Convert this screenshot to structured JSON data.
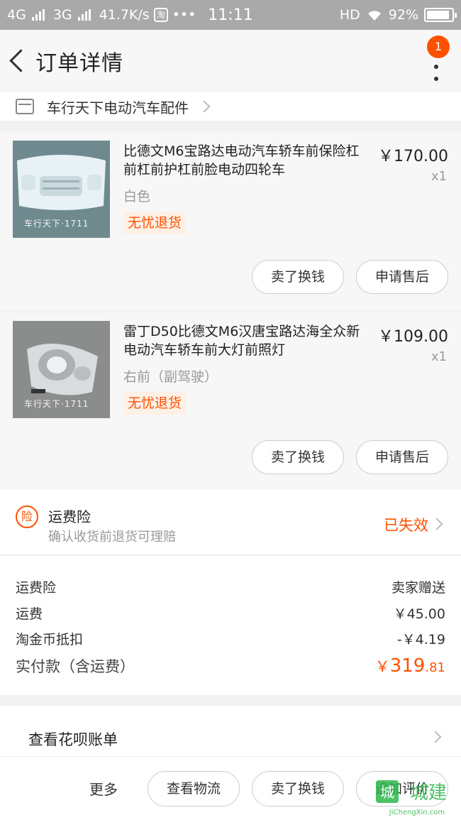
{
  "status_bar": {
    "network1": "4G",
    "network2": "3G",
    "speed": "41.7K/s",
    "app_icon": "淘",
    "dots": "•••",
    "time": "11:11",
    "hd": "HD",
    "battery": "92%"
  },
  "nav": {
    "title": "订单详情",
    "badge": "1"
  },
  "shop": {
    "name": "车行天下电动汽车配件"
  },
  "items": [
    {
      "title": "比德文M6宝路达电动汽车轿车前保险杠前杠前护杠前脸电动四轮车",
      "spec": "白色",
      "tag": "无忧退货",
      "price": "￥170.00",
      "qty": "x1",
      "image_caption": "车行天下·1711",
      "btn_exchange": "卖了换钱",
      "btn_aftersale": "申请售后"
    },
    {
      "title": "雷丁D50比德文M6汉唐宝路达海全众新电动汽车轿车前大灯前照灯",
      "spec": "右前（副驾驶）",
      "tag": "无忧退货",
      "price": "￥109.00",
      "qty": "x1",
      "image_caption": "车行天下·1711",
      "btn_exchange": "卖了换钱",
      "btn_aftersale": "申请售后"
    }
  ],
  "insurance": {
    "icon": "险",
    "title": "运费险",
    "subtitle": "确认收货前退货可理赔",
    "status": "已失效"
  },
  "summary": {
    "rows": [
      {
        "label": "运费险",
        "value": "卖家赠送"
      },
      {
        "label": "运费",
        "value": "￥45.00"
      },
      {
        "label": "淘金币抵扣",
        "value": "-￥4.19"
      }
    ],
    "total_label": "实付款（含运费）",
    "total_currency": "￥",
    "total_int": "319",
    "total_dec": ".81"
  },
  "huabei": {
    "label": "查看花呗账单"
  },
  "bottom_bar": {
    "more": "更多",
    "logistics": "查看物流",
    "exchange": "卖了换钱",
    "review": "追加评价"
  },
  "watermark": {
    "text": "城建",
    "sub": "JiChengXin.com"
  },
  "colors": {
    "accent": "#ff5000",
    "status_bar": "#a9a9a9"
  }
}
